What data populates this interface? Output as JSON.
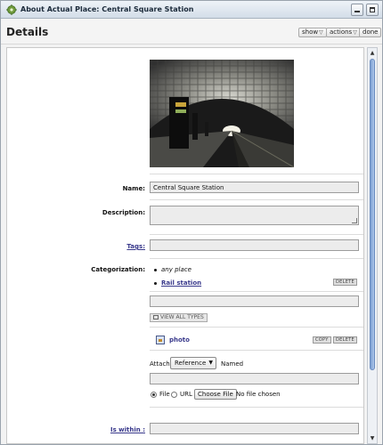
{
  "window": {
    "title": "About Actual Place: Central Square Station",
    "minimize_icon": "minimize-icon",
    "maximize_icon": "maximize-icon"
  },
  "header": {
    "title": "Details",
    "buttons": {
      "show": "show",
      "actions": "actions",
      "done": "done"
    }
  },
  "details": {
    "photo_alt": "subway station vaulted ceiling photo",
    "name": {
      "label": "Name:",
      "value": "Central Square Station"
    },
    "description": {
      "label": "Description:",
      "value": ""
    },
    "tags": {
      "label": "Tags:",
      "value": ""
    },
    "categorization": {
      "label": "Categorization:",
      "items": [
        {
          "text": "any place"
        },
        {
          "text": "Rail station",
          "delete_label": "DELETE"
        }
      ],
      "new_value": "",
      "view_all_label": "VIEW ALL TYPES"
    },
    "attachment": {
      "name": "photo",
      "copy_label": "COPY",
      "delete_label": "DELETE",
      "attach_label": "Attach:",
      "attach_selected": "Reference",
      "named_label": "Named",
      "named_value": "",
      "file_label": "File",
      "url_label": "URL",
      "choose_file_label": "Choose File",
      "no_file_label": "No file chosen",
      "source_selected": "File"
    },
    "is_within": {
      "label": "Is within :",
      "value": ""
    }
  },
  "colors": {
    "link": "#3a3a8c",
    "titlebar_top": "#eef3f8",
    "titlebar_bottom": "#d3dde8",
    "scroll_thumb": "#7b9fd2"
  }
}
